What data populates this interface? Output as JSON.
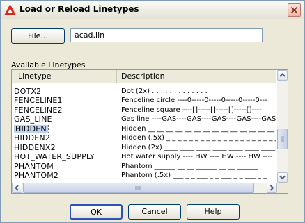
{
  "window": {
    "title": "Load or Reload Linetypes",
    "icon": "autocad-a-icon",
    "accent_color": "#d8261c"
  },
  "file": {
    "button_label": "File...",
    "path_value": "acad.lin"
  },
  "available": {
    "label": "Available Linetypes",
    "columns": {
      "linetype": "Linetype",
      "description": "Description"
    },
    "rows": [
      {
        "name": "DOTX2",
        "description": "Dot (2x) . . . . . . . . . . . . ."
      },
      {
        "name": "FENCELINE1",
        "description": "Fenceline circle ----0-----0-----0-----0-----0---"
      },
      {
        "name": "FENCELINE2",
        "description": "Fenceline square ----[]-----[]-----[]-----[]----"
      },
      {
        "name": "GAS_LINE",
        "description": "Gas line ----GAS----GAS----GAS----GAS----GAS--"
      },
      {
        "name": "HIDDEN",
        "description": "Hidden __ __ __ __ __ __ __ __ __ __ __ __ __ __ .",
        "selected": true
      },
      {
        "name": "HIDDEN2",
        "description": "Hidden (.5x) _ _ _ _ _ _ _ _ _ _ _ _ _ _ _ _ _ _ _ _"
      },
      {
        "name": "HIDDENX2",
        "description": "Hidden (2x) ____ ____ ____ ____ ____ ____ ____"
      },
      {
        "name": "HOT_WATER_SUPPLY",
        "description": "Hot water supply ---- HW ---- HW ---- HW ----"
      },
      {
        "name": "PHANTOM",
        "description": "Phantom ______ __ __ ______ __ __ ______"
      },
      {
        "name": "PHANTOM2",
        "description": "Phantom (.5x) ___ _ _ ___ _ _ ___ _ _ ___ _ _"
      }
    ]
  },
  "buttons": {
    "ok": "OK",
    "cancel": "Cancel",
    "help": "Help"
  }
}
